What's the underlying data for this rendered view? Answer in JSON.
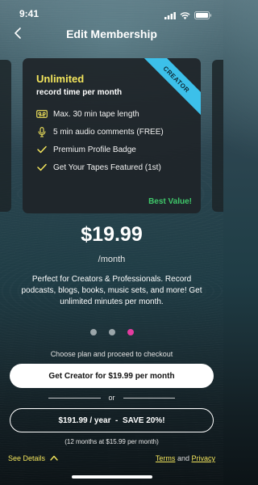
{
  "status_bar": {
    "time": "9:41"
  },
  "header": {
    "title": "Edit Membership"
  },
  "plan_card": {
    "ribbon": "CREATOR",
    "name": "Unlimited",
    "subtitle": "record time per month",
    "features": [
      {
        "icon": "cassette-icon",
        "text": "Max. 30 min tape length"
      },
      {
        "icon": "microphone-icon",
        "text": "5 min audio comments (FREE)"
      },
      {
        "icon": "check-icon",
        "text": "Premium Profile Badge"
      },
      {
        "icon": "check-icon",
        "text": "Get Your Tapes Featured (1st)"
      }
    ],
    "badge": "Best Value!"
  },
  "pricing": {
    "price": "$19.99",
    "period": "/month",
    "description": "Perfect for Creators & Professionals. Record podcasts, blogs, books, music sets, and more! Get unlimited minutes per month."
  },
  "carousel": {
    "dots": 3,
    "active_index": 2
  },
  "checkout": {
    "prompt": "Choose plan and proceed to checkout",
    "primary_button": "Get Creator for $19.99 per month",
    "or_text": "or",
    "yearly_button": "$191.99 / year  -  SAVE 20%!",
    "yearly_note": "(12 months at $15.99 per month)"
  },
  "footer": {
    "see_details": "See Details",
    "terms": "Terms",
    "and": "and",
    "privacy": "Privacy"
  },
  "colors": {
    "accent_yellow": "#f3e55c",
    "ribbon_blue": "#3cc0ea",
    "best_value_green": "#3fc86a",
    "active_dot": "#e33c9f"
  }
}
